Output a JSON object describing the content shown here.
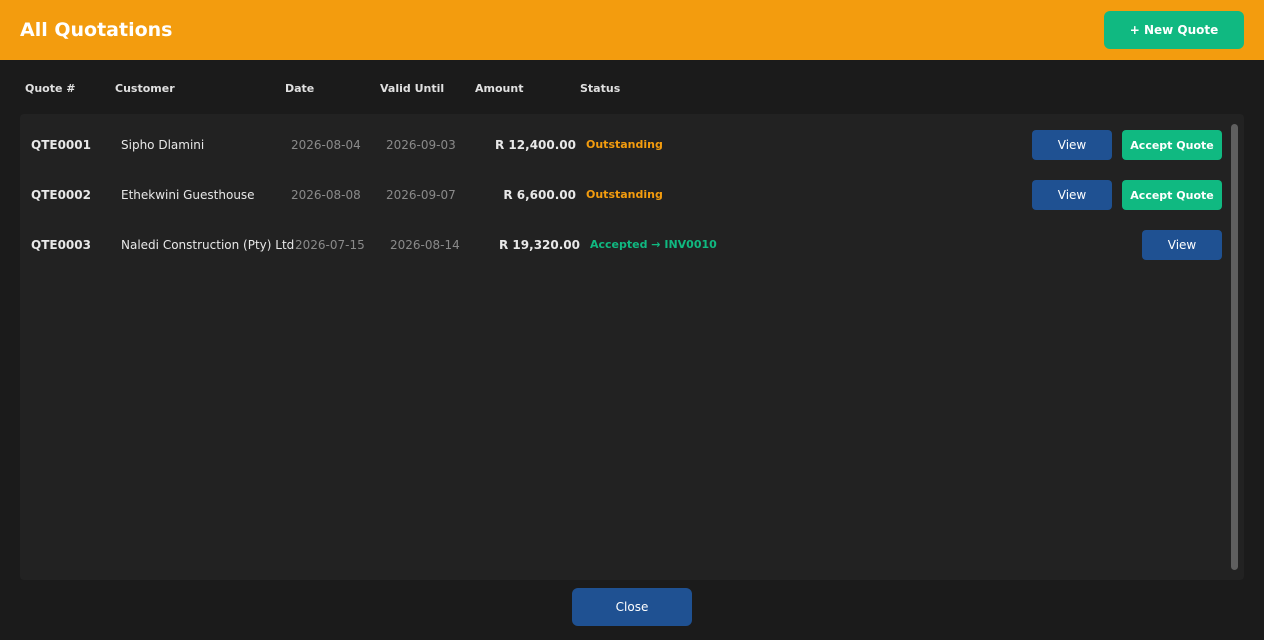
{
  "header": {
    "title": "All Quotations",
    "new_quote_label": "+ New Quote"
  },
  "columns": {
    "quote_num": "Quote #",
    "customer": "Customer",
    "date": "Date",
    "valid_until": "Valid Until",
    "amount": "Amount",
    "status": "Status"
  },
  "rows": [
    {
      "quote_num": "QTE0001",
      "customer": "Sipho Dlamini",
      "date": "2026-08-04",
      "valid_until": "2026-09-03",
      "amount": "R 12,400.00",
      "status": "Outstanding",
      "view_label": "View",
      "accept_label": "Accept Quote"
    },
    {
      "quote_num": "QTE0002",
      "customer": "Ethekwini Guesthouse",
      "date": "2026-08-08",
      "valid_until": "2026-09-07",
      "amount": "R 6,600.00",
      "status": "Outstanding",
      "view_label": "View",
      "accept_label": "Accept Quote"
    },
    {
      "quote_num": "QTE0003",
      "customer": "Naledi Construction (Pty) Ltd",
      "date": "2026-07-15",
      "valid_until": "2026-08-14",
      "amount": "R 19,320.00",
      "status": "Accepted → INV0010",
      "view_label": "View"
    }
  ],
  "footer": {
    "close_label": "Close"
  },
  "colors": {
    "header_bg": "#f39c0e",
    "accent_green": "#10b981",
    "button_blue": "#1f5192",
    "status_outstanding": "#f39c0e",
    "status_accepted": "#10b981"
  }
}
